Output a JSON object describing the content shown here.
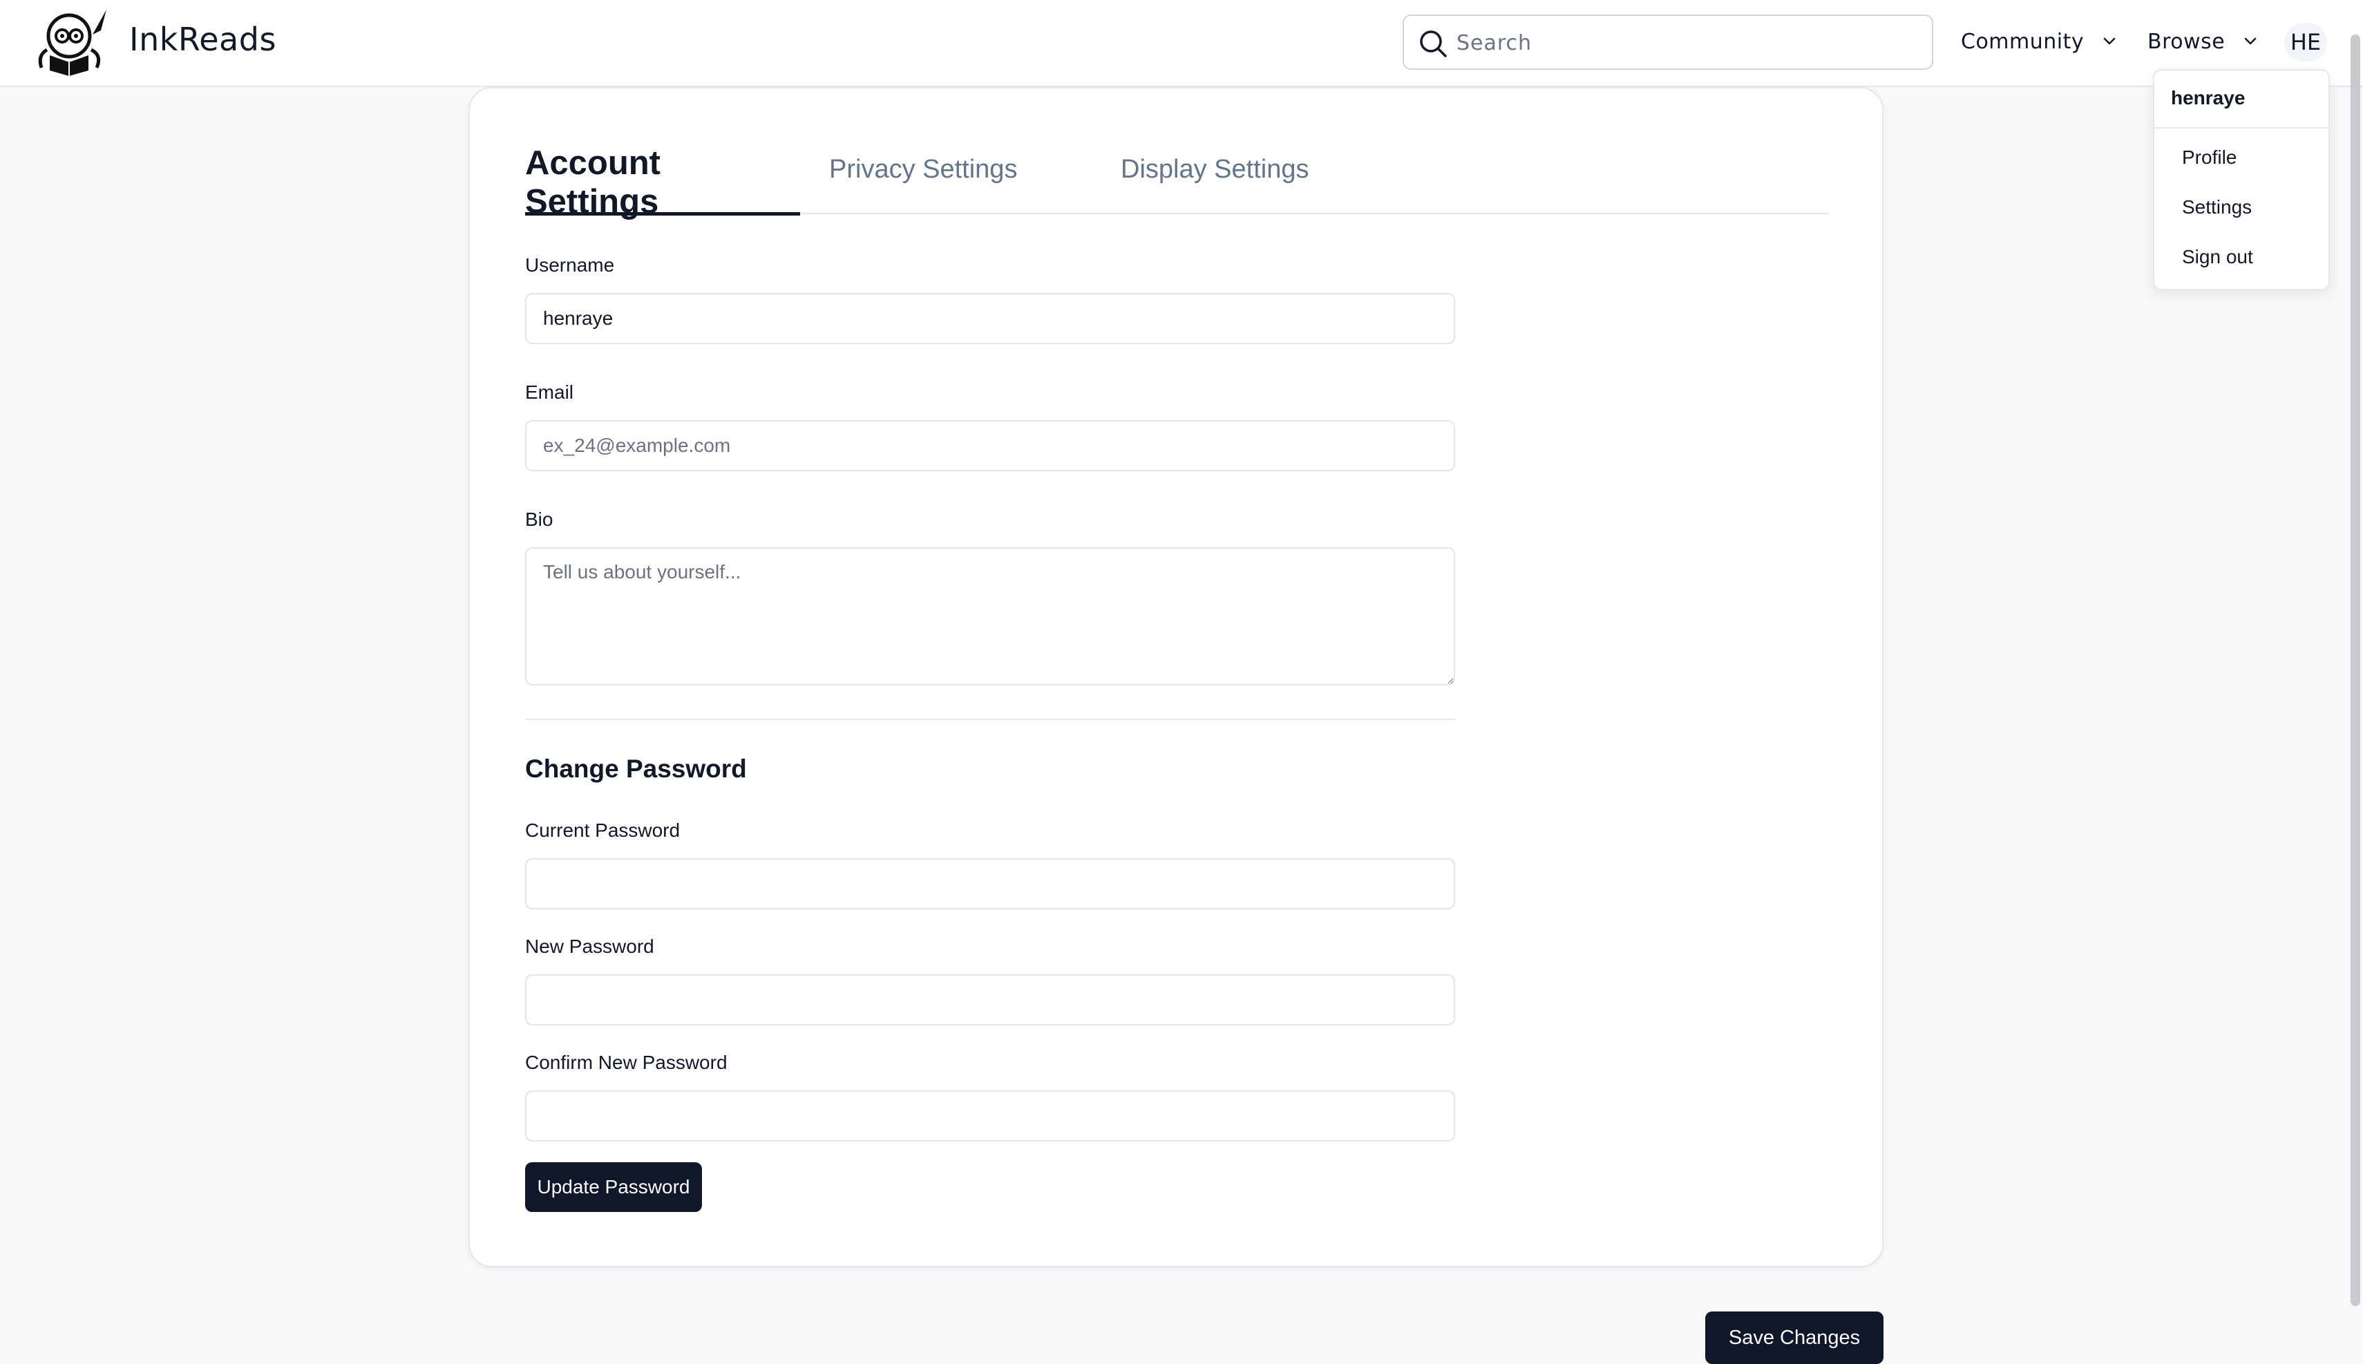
{
  "app": {
    "brand": "InkReads"
  },
  "header": {
    "search": {
      "placeholder": "Search"
    },
    "nav": {
      "community": "Community",
      "browse": "Browse"
    },
    "avatar_initials": "HE"
  },
  "user_menu": {
    "username": "henraye",
    "items": [
      "Profile",
      "Settings",
      "Sign out"
    ]
  },
  "settings": {
    "tabs": [
      "Account Settings",
      "Privacy Settings",
      "Display Settings"
    ],
    "active_tab": "Account Settings",
    "username": {
      "label": "Username",
      "value": "henraye"
    },
    "email": {
      "label": "Email",
      "placeholder": "ex_24@example.com"
    },
    "bio": {
      "label": "Bio",
      "placeholder": "Tell us about yourself..."
    },
    "change_password": {
      "title": "Change Password",
      "current_label": "Current Password",
      "new_label": "New Password",
      "confirm_label": "Confirm New Password",
      "update_button": "Update Password"
    },
    "save_button": "Save Changes"
  },
  "colors": {
    "primary_button": "#0f172a",
    "muted_text": "#64748b",
    "border": "#e5e7eb"
  }
}
